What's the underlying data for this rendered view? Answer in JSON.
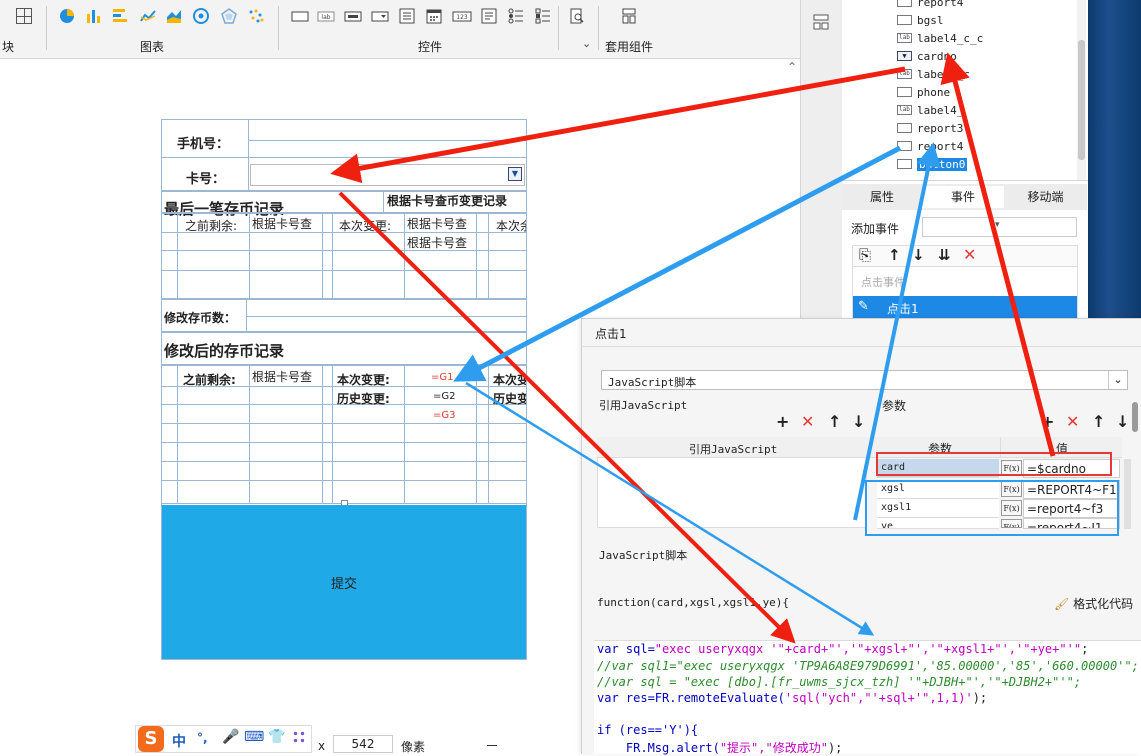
{
  "toolbar": {
    "left_partial_label": "块",
    "chart_group_label": "图表",
    "control_group_label": "控件",
    "preset_group_label": "套用组件"
  },
  "tree": {
    "items": [
      {
        "name": "report4_partial",
        "label": "report4",
        "type": "rect"
      },
      {
        "name": "bgsl",
        "label": "bgsl",
        "type": "rect"
      },
      {
        "name": "label4_c_c",
        "label": "label4_c_c",
        "type": "lab"
      },
      {
        "name": "cardno",
        "label": "cardno",
        "type": "combo"
      },
      {
        "name": "label4_c",
        "label": "label4_c",
        "type": "lab"
      },
      {
        "name": "phone",
        "label": "phone",
        "type": "rect"
      },
      {
        "name": "label4",
        "label": "label4_",
        "type": "lab"
      },
      {
        "name": "report3",
        "label": "report3",
        "type": "rect"
      },
      {
        "name": "report4",
        "label": "report4",
        "type": "rect"
      },
      {
        "name": "button0",
        "label": "button0",
        "type": "button"
      }
    ]
  },
  "right_tabs": {
    "properties": "属性",
    "events": "事件",
    "mobile": "移动端"
  },
  "event_panel": {
    "add_event_label": "添加事件",
    "click_event_placeholder": "点击事件",
    "selected_event": "点击1"
  },
  "form": {
    "phone_label": "手机号：",
    "card_label": "卡号：",
    "last_record_title": "最后一笔存币记录",
    "query_by_card_title": "根据卡号查币变更记录",
    "prev_balance": "之前剩余:",
    "query_by_card": "根据卡号查",
    "this_change": "本次变更:",
    "this_remain_partial": "本次余",
    "modify_count_label": "修改存币数：",
    "modified_record_title": "修改后的存币记录",
    "prev_balance2": "之前剩余:",
    "this_change2": "本次变更:",
    "history_change": "历史变更:",
    "formula_g1": "=G1",
    "formula_g2": "=G2",
    "formula_g3": "=G3",
    "this_change_partial": "本次变",
    "history_partial": "历史变",
    "submit_button": "提交"
  },
  "dialog": {
    "title": "点击1",
    "type_select": "JavaScript脚本",
    "ref_js_section": "引用JavaScript",
    "params_section": "参数",
    "ref_js_col": "引用JavaScript",
    "param_col": "参数",
    "value_col": "值",
    "params": [
      {
        "name": "card",
        "value": "=$cardno"
      },
      {
        "name": "xgsl",
        "value": "=REPORT4~F1"
      },
      {
        "name": "xgsl1",
        "value": "=report4~f3"
      },
      {
        "name": "ye",
        "value": "=report4~I1"
      }
    ],
    "script_section": "JavaScript脚本",
    "function_sig": "function(card,xgsl,xgsl1,ye){",
    "format_code_label": "格式化代码",
    "code": {
      "line1_a": "var sql=",
      "line1_b": "\"exec useryxqgx '\"+card+\"','\"+xgsl+\"','\"+xgsl1+\"','\"+ye+\"'\"",
      "line1_c": ";",
      "line2": "//var sql1=\"exec useryxqgx 'TP9A6A8E979D6991','85.00000','85','660.00000'\";",
      "line3": "//var sql = \"exec [dbo].[fr_uwms_sjcx_tzh] '\"+DJBH+\"','\"+DJBH2+\"'\";",
      "line4_a": "var res=FR.remoteEvaluate(",
      "line4_b": "'sql(\"ych\",\"'+sql+'\",1,1)'",
      "line4_c": ");",
      "line5": "if (res=='Y'){",
      "line6_a": "    FR.Msg.alert(",
      "line6_b": "\"提示\",\"修改成功\"",
      "line6_c": ");"
    }
  },
  "statusbar": {
    "x_label": "x",
    "width_value": "542",
    "unit": "像素"
  },
  "ime": {
    "zh": "中",
    "punct": "°,"
  },
  "colors": {
    "accent_blue": "#1fa9e6",
    "arrow_red": "#f02010",
    "arrow_blue": "#2e9df0",
    "selected_bg": "#1e88e5",
    "dark_blue_edge": "#0d3a6e"
  }
}
